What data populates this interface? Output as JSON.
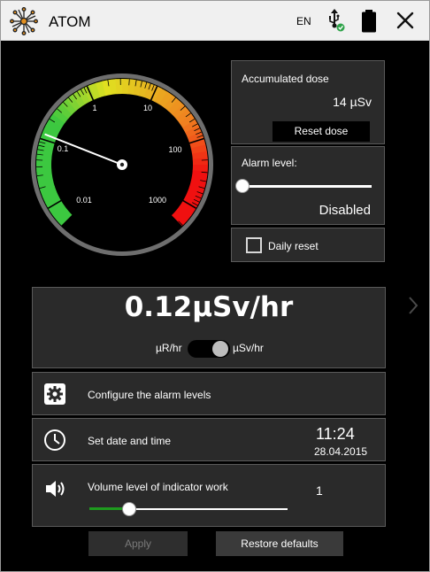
{
  "titlebar": {
    "app_title": "ATOM",
    "language": "EN",
    "icons": [
      "atom-logo-icon",
      "usb-connected-icon",
      "battery-icon",
      "close-icon"
    ]
  },
  "gauge": {
    "scale_labels": [
      "0.01",
      "0.1",
      "1",
      "10",
      "100",
      "1000"
    ],
    "needle_value": 0.12,
    "colors": {
      "green": "#3cc840",
      "yellow": "#e0e020",
      "orange": "#f08020",
      "red": "#f01010"
    }
  },
  "accumulated": {
    "label": "Accumulated dose",
    "value": "14 µSv",
    "reset_label": "Reset dose"
  },
  "alarm": {
    "label": "Alarm level:",
    "status": "Disabled",
    "slider_fraction": 0.0
  },
  "daily_reset": {
    "label": "Daily reset",
    "checked": false
  },
  "readout": {
    "value": "0.12µSv/hr",
    "unit_left": "µR/hr",
    "unit_right": "µSv/hr"
  },
  "settings": {
    "alarm_config_label": "Configure the alarm levels",
    "datetime_label": "Set date and time",
    "time": "11:24",
    "date": "28.04.2015",
    "volume_label": "Volume level of indicator work",
    "volume_value": "1",
    "volume_fraction": 0.2
  },
  "footer": {
    "apply_label": "Apply",
    "restore_label": "Restore defaults"
  }
}
